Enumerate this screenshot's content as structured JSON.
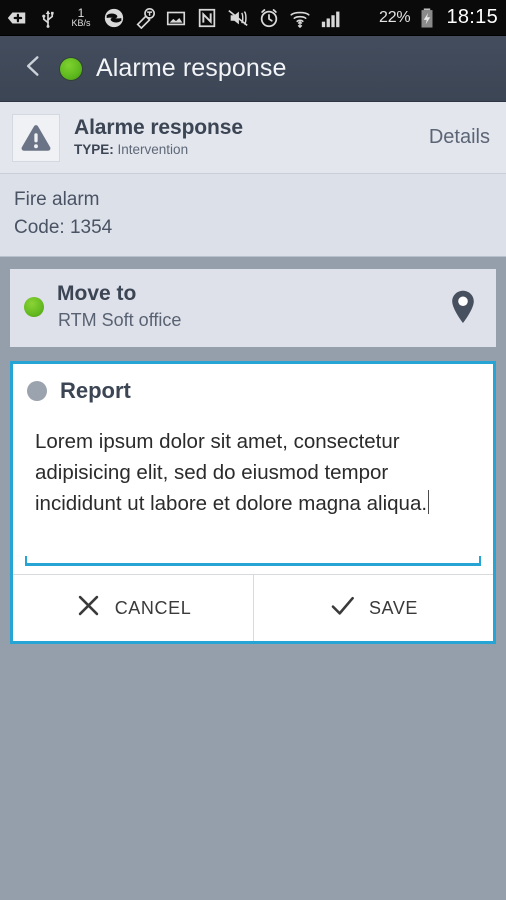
{
  "statusbar": {
    "icons": [
      {
        "name": "download-arrow-icon"
      },
      {
        "name": "usb-icon"
      },
      {
        "name": "data-rate-icon"
      },
      {
        "name": "browser-icon"
      },
      {
        "name": "tmobile-key-icon"
      },
      {
        "name": "screenshot-image-icon"
      },
      {
        "name": "nfc-icon"
      },
      {
        "name": "vibrate-mute-icon"
      },
      {
        "name": "alarm-clock-icon"
      },
      {
        "name": "wifi-icon"
      },
      {
        "name": "signal-bars-icon"
      }
    ],
    "data_rate_value": "1",
    "data_rate_unit": "KB/s",
    "battery_percent": "22%",
    "clock": "18:15"
  },
  "actionbar": {
    "back_icon": "back-chevron-icon",
    "status_dot_color": "#5cb71d",
    "title": "Alarme response"
  },
  "infobar": {
    "icon": "warning-triangle-icon",
    "title": "Alarme response",
    "type_label": "TYPE:",
    "type_value": "Intervention",
    "details_label": "Details"
  },
  "description": {
    "line1": "Fire alarm",
    "line2": "Code: 1354"
  },
  "move_card": {
    "status_dot_color": "#63b81f",
    "title": "Move to",
    "subtitle": "RTM Soft office",
    "icon": "map-pin-icon"
  },
  "report_card": {
    "accent_color": "#26a5d4",
    "status_dot_color": "#9ba3ae",
    "title": "Report",
    "text_value": "Lorem ipsum dolor sit amet, consectetur adipisicing elit, sed do eiusmod tempor incididunt ut labore et dolore magna aliqua.",
    "text_placeholder": "Report",
    "cancel_label": "CANCEL",
    "cancel_icon": "close-x-icon",
    "save_label": "SAVE",
    "save_icon": "checkmark-icon"
  }
}
